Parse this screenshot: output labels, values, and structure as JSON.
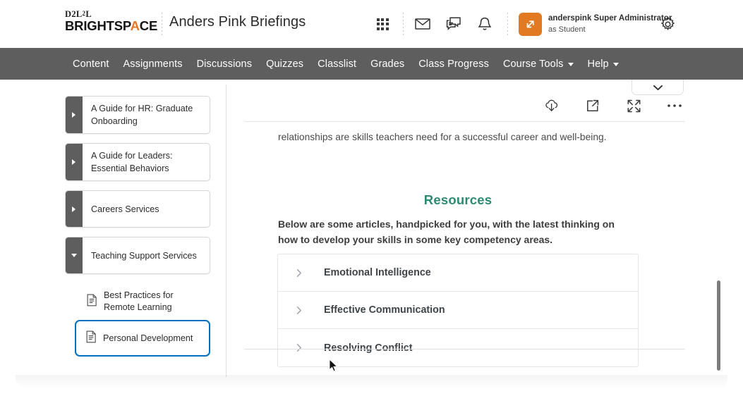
{
  "header": {
    "brand": {
      "top": "D2L",
      "top_sup": "2",
      "bottom_pre": "BRIGHTSP",
      "bottom_accent": "A",
      "bottom_post": "CE"
    },
    "course_title": "Anders Pink Briefings",
    "icons": [
      {
        "name": "waffle-icon",
        "label": "Course Selector"
      },
      {
        "name": "mail-icon",
        "label": "Message Alerts"
      },
      {
        "name": "chat-icon",
        "label": "Subscription Alerts"
      },
      {
        "name": "bell-icon",
        "label": "Update Alerts"
      },
      {
        "name": "gear-icon",
        "label": "Settings"
      }
    ],
    "role": {
      "name": "anderspink Super Administrator",
      "subtitle": "as Student",
      "badge_icon": "role-switch-icon",
      "badge_color": "#e17a23"
    }
  },
  "nav": {
    "items": [
      {
        "label": "Content",
        "caret": false
      },
      {
        "label": "Assignments",
        "caret": false
      },
      {
        "label": "Discussions",
        "caret": false
      },
      {
        "label": "Quizzes",
        "caret": false
      },
      {
        "label": "Classlist",
        "caret": false
      },
      {
        "label": "Grades",
        "caret": false
      },
      {
        "label": "Class Progress",
        "caret": false
      },
      {
        "label": "Course Tools",
        "caret": true
      },
      {
        "label": "Help",
        "caret": true
      }
    ],
    "background": "#5e5e5e"
  },
  "sidebar": {
    "units": [
      {
        "label": "A Guide for HR: Graduate Onboarding",
        "expanded": false
      },
      {
        "label": "A Guide for Leaders: Essential Behaviors",
        "expanded": false
      },
      {
        "label": "Careers Services",
        "expanded": false
      },
      {
        "label": "Teaching Support Services",
        "expanded": true
      }
    ],
    "topics": [
      {
        "label": "Best Practices for Remote Learning",
        "icon": "document-icon",
        "selected": false
      },
      {
        "label": "Personal Development",
        "icon": "document-icon",
        "selected": true
      }
    ],
    "selected_outline_color": "#006fbf"
  },
  "content": {
    "toolbar": [
      {
        "name": "download-icon",
        "label": "Download"
      },
      {
        "name": "external-link-icon",
        "label": "Open in New Window"
      },
      {
        "name": "expand-icon",
        "label": "Full Screen"
      },
      {
        "name": "more-options-icon",
        "label": "More Actions"
      }
    ],
    "dropdown_icon": "chevron-down-icon",
    "paragraph_tail": "relationships are skills teachers need for a successful career and well-being.",
    "resources_heading": "Resources",
    "resources_heading_color": "#2e8a72",
    "resources_intro": "Below are some articles, handpicked for you, with the latest thinking on how to develop your skills in some key competency areas.",
    "accordion": [
      {
        "title": "Emotional Intelligence",
        "expanded": false,
        "icon": "chevron-right-icon"
      },
      {
        "title": "Effective Communication",
        "expanded": false,
        "icon": "chevron-right-icon"
      },
      {
        "title": "Resolving Conflict",
        "expanded": false,
        "icon": "chevron-right-icon"
      }
    ]
  }
}
